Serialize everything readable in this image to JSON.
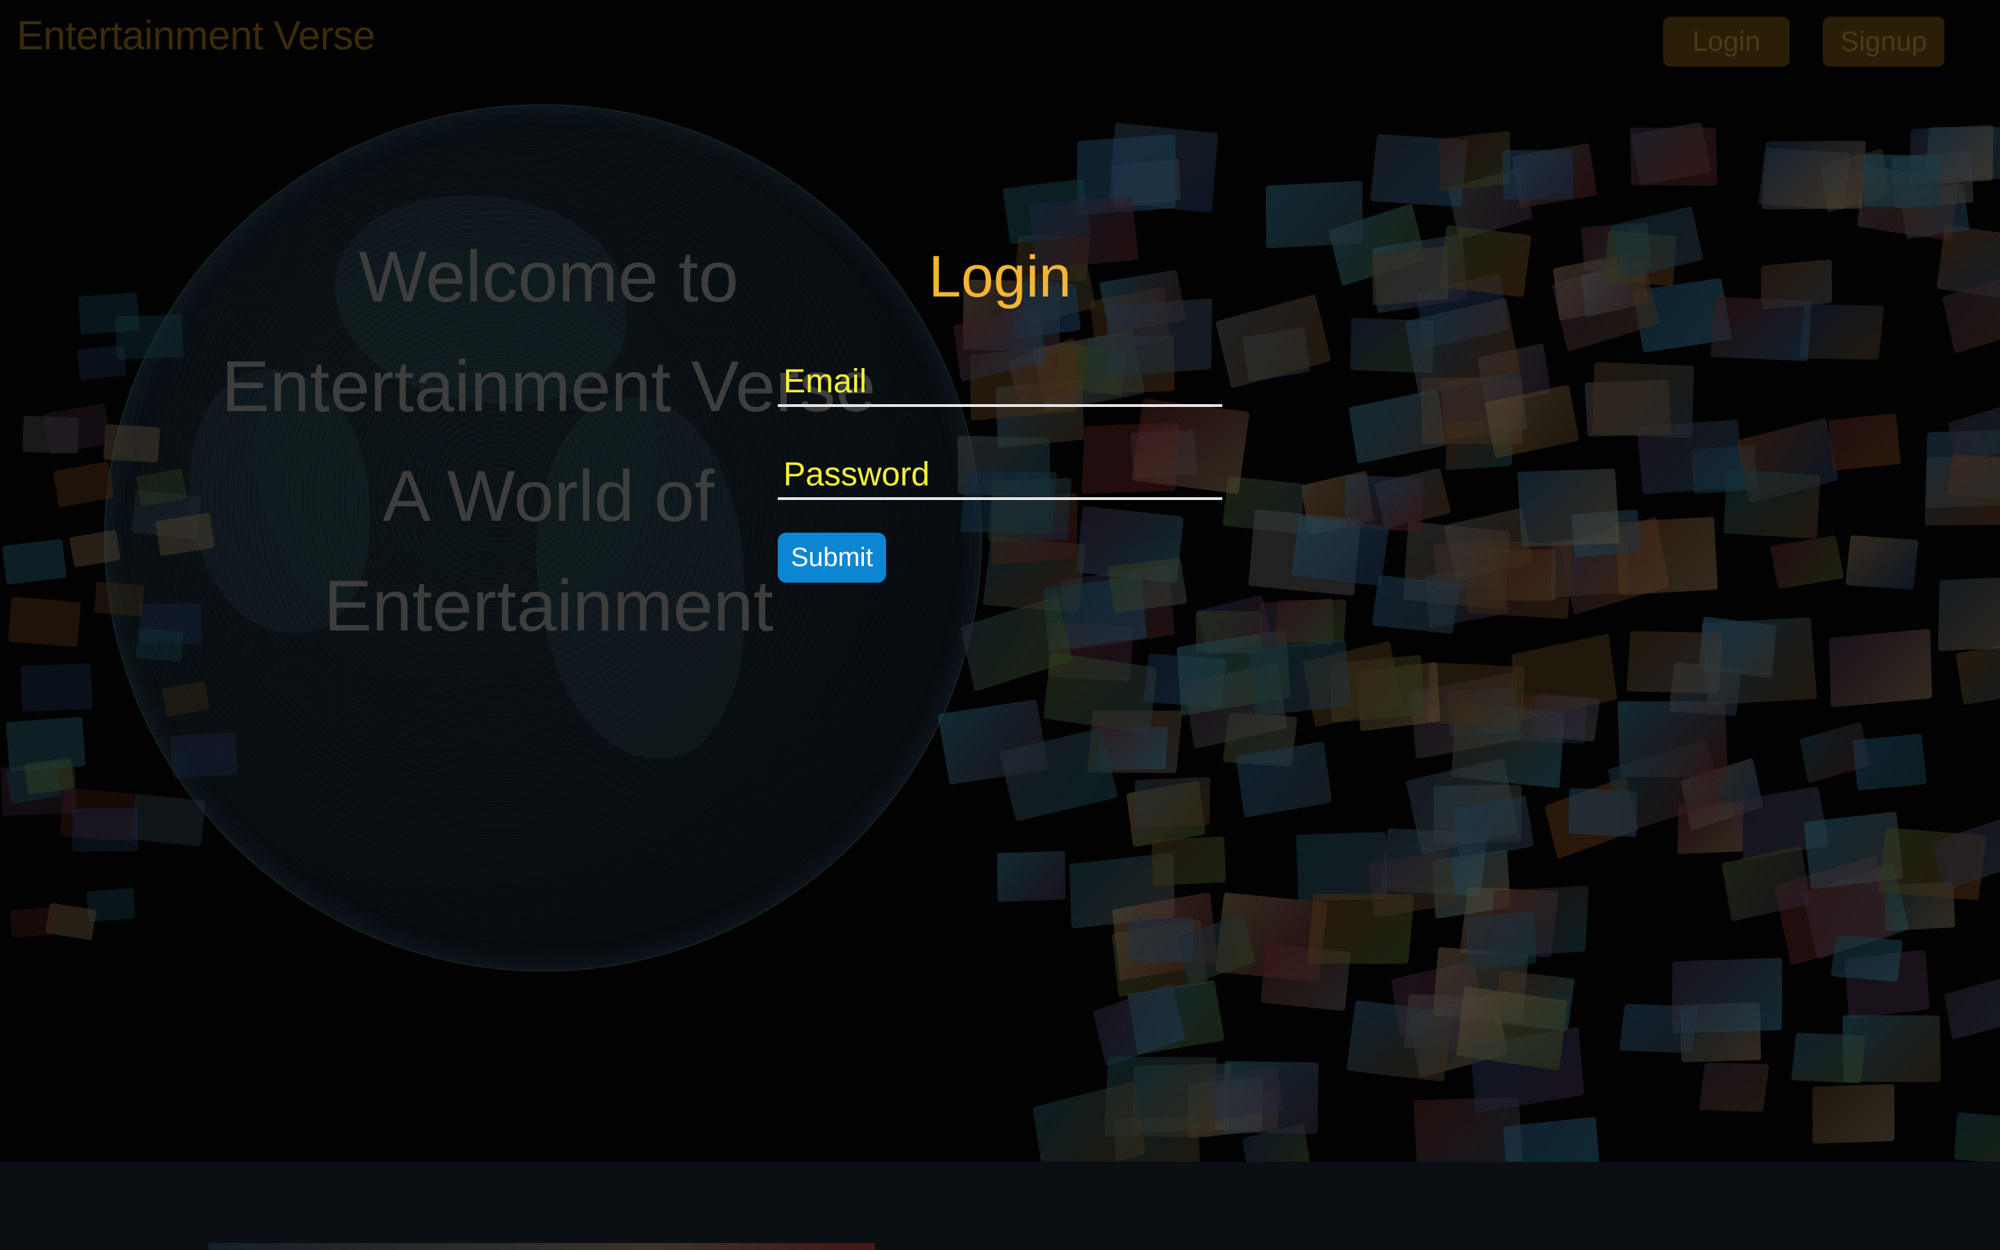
{
  "header": {
    "brand": "Entertainment Verse",
    "login_label": "Login",
    "signup_label": "Signup"
  },
  "hero": {
    "welcome_lines": [
      "Welcome to",
      "Entertainment Verse",
      "A World of",
      "Entertainment"
    ]
  },
  "login_form": {
    "title": "Login",
    "email_placeholder": "Email",
    "email_value": "",
    "password_placeholder": "Password",
    "password_value": "",
    "submit_label": "Submit"
  },
  "colors": {
    "title_accent": "#f3b533",
    "field_text": "#f7f233",
    "submit_bg": "#0b86d2",
    "nav_button_bg": "#2a1e07",
    "brand_text": "#3c2b0a"
  }
}
